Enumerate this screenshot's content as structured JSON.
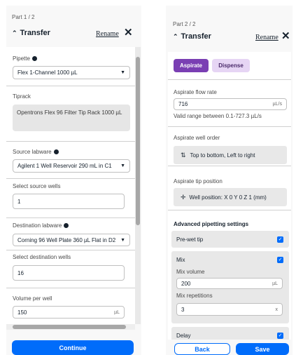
{
  "left": {
    "part_label": "Part 1 / 2",
    "title": "Transfer",
    "rename": "Rename",
    "pipette": {
      "label": "Pipette",
      "value": "Flex 1-Channel 1000 µL"
    },
    "tiprack": {
      "label": "Tiprack",
      "value": "Opentrons Flex 96 Filter Tip Rack 1000 µL"
    },
    "source_labware": {
      "label": "Source labware",
      "value": "Agilent 1 Well Reservoir 290 mL in C1"
    },
    "source_wells": {
      "label": "Select source wells",
      "value": "1"
    },
    "dest_labware": {
      "label": "Destination labware",
      "value": "Corning 96 Well Plate 360 µL Flat in D2"
    },
    "dest_wells": {
      "label": "Select destination wells",
      "value": "16"
    },
    "volume": {
      "label": "Volume per well",
      "value": "150",
      "unit": "µL"
    },
    "continue": "Continue"
  },
  "right": {
    "part_label": "Part 2 / 2",
    "title": "Transfer",
    "rename": "Rename",
    "tabs": [
      "Aspirate",
      "Dispense"
    ],
    "flow_rate": {
      "label": "Aspirate flow rate",
      "value": "716",
      "unit": "µL/s",
      "hint": "Valid range between 0.1-727.3 µL/s"
    },
    "well_order": {
      "label": "Aspirate well order",
      "value": "Top to bottom, Left to right"
    },
    "tip_position": {
      "label": "Aspirate tip position",
      "value": "Well position: X 0 Y 0 Z 1 (mm)"
    },
    "advanced": {
      "heading": "Advanced pipetting settings",
      "prewet": "Pre-wet tip",
      "mix": "Mix",
      "mix_volume_label": "Mix volume",
      "mix_volume": "200",
      "mix_volume_unit": "µL",
      "mix_reps_label": "Mix repetitions",
      "mix_reps": "3",
      "mix_reps_unit": "x",
      "delay": "Delay"
    },
    "back": "Back",
    "save": "Save"
  },
  "colors": {
    "primary": "#006cfa",
    "aspirate_tab": "#7a3fb3",
    "dispense_tab": "#e6d5f4"
  }
}
